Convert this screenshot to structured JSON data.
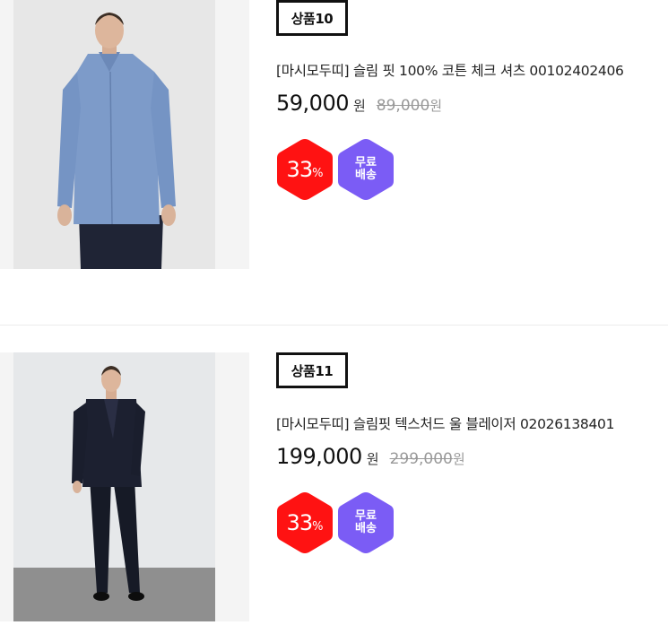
{
  "products": [
    {
      "label": "상품10",
      "name": "[마시모두띠] 슬림 핏 100% 코튼 체크 셔츠 00102402406",
      "price": "59,000",
      "price_unit": "원",
      "original_price": "89,000",
      "original_unit": "원",
      "discount_value": "33",
      "discount_unit": "%",
      "shipping_badge": "무료 배송",
      "colors": {
        "discount": "#ff1212",
        "shipping": "#7b5cf5"
      }
    },
    {
      "label": "상품11",
      "name": "[마시모두띠] 슬림핏 텍스처드 울 블레이저 02026138401",
      "price": "199,000",
      "price_unit": "원",
      "original_price": "299,000",
      "original_unit": "원",
      "discount_value": "33",
      "discount_unit": "%",
      "shipping_badge": "무료 배송",
      "colors": {
        "discount": "#ff1212",
        "shipping": "#7b5cf5"
      }
    }
  ]
}
